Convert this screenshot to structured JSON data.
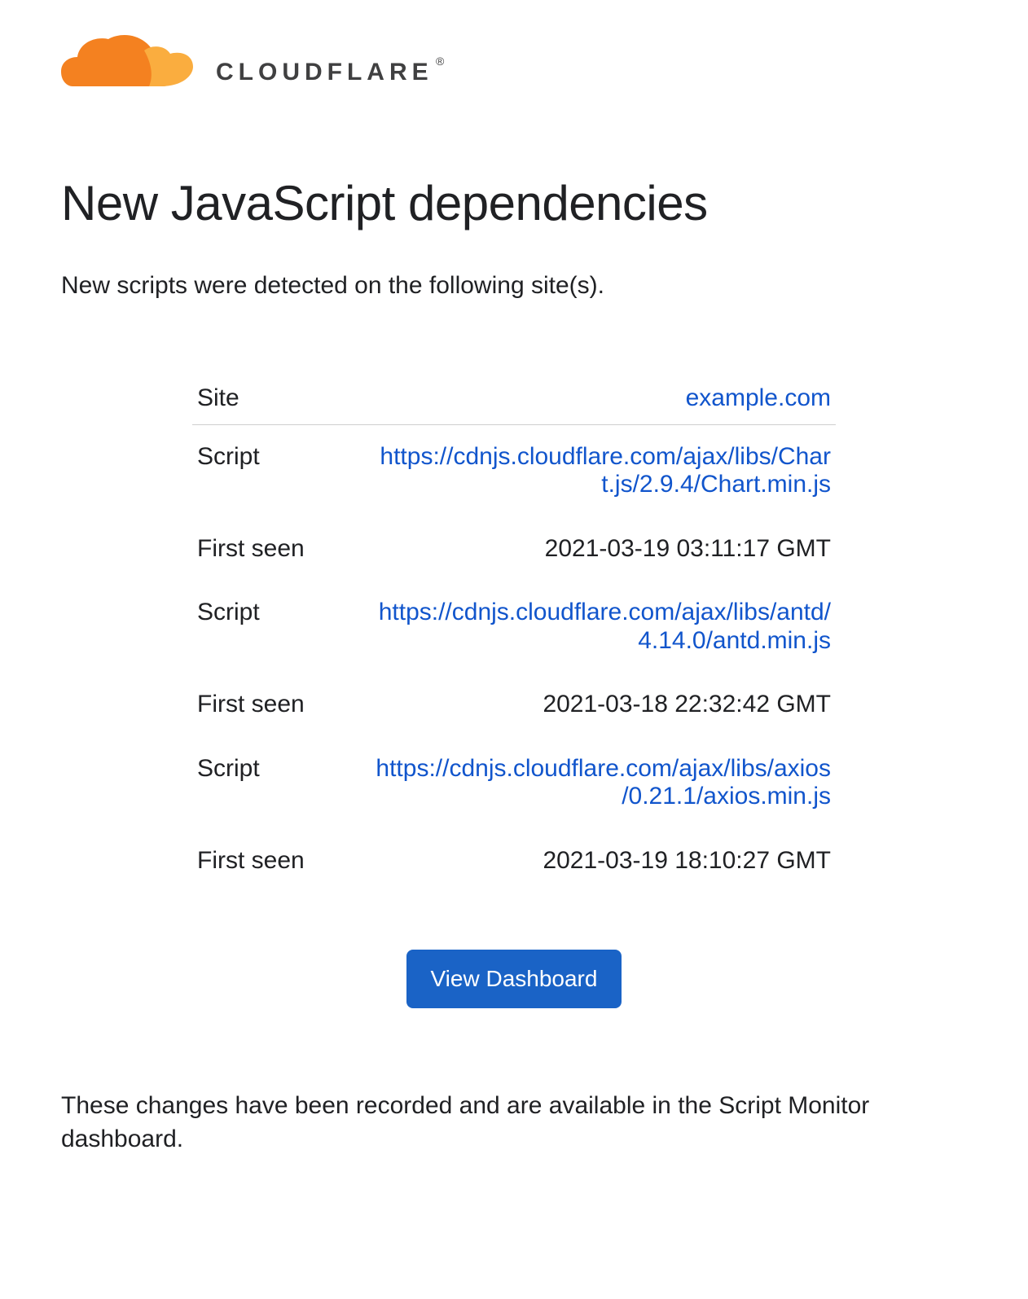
{
  "brand": {
    "name": "CLOUDFLARE"
  },
  "page": {
    "title": "New JavaScript dependencies",
    "intro": "New scripts were detected on the following site(s).",
    "footer": "These changes have been recorded and are available in the Script Monitor dashboard."
  },
  "labels": {
    "site": "Site",
    "script": "Script",
    "first_seen": "First seen"
  },
  "site": {
    "domain": "example.com"
  },
  "scripts": [
    {
      "url": "https://cdnjs.cloudflare.com/ajax/libs/Chart.js/2.9.4/Chart.min.js",
      "first_seen": "2021-03-19 03:11:17 GMT"
    },
    {
      "url": "https://cdnjs.cloudflare.com/ajax/libs/antd/4.14.0/antd.min.js",
      "first_seen": "2021-03-18 22:32:42 GMT"
    },
    {
      "url": "https://cdnjs.cloudflare.com/ajax/libs/axios/0.21.1/axios.min.js",
      "first_seen": "2021-03-19 18:10:27 GMT"
    }
  ],
  "cta": {
    "label": "View Dashboard"
  }
}
